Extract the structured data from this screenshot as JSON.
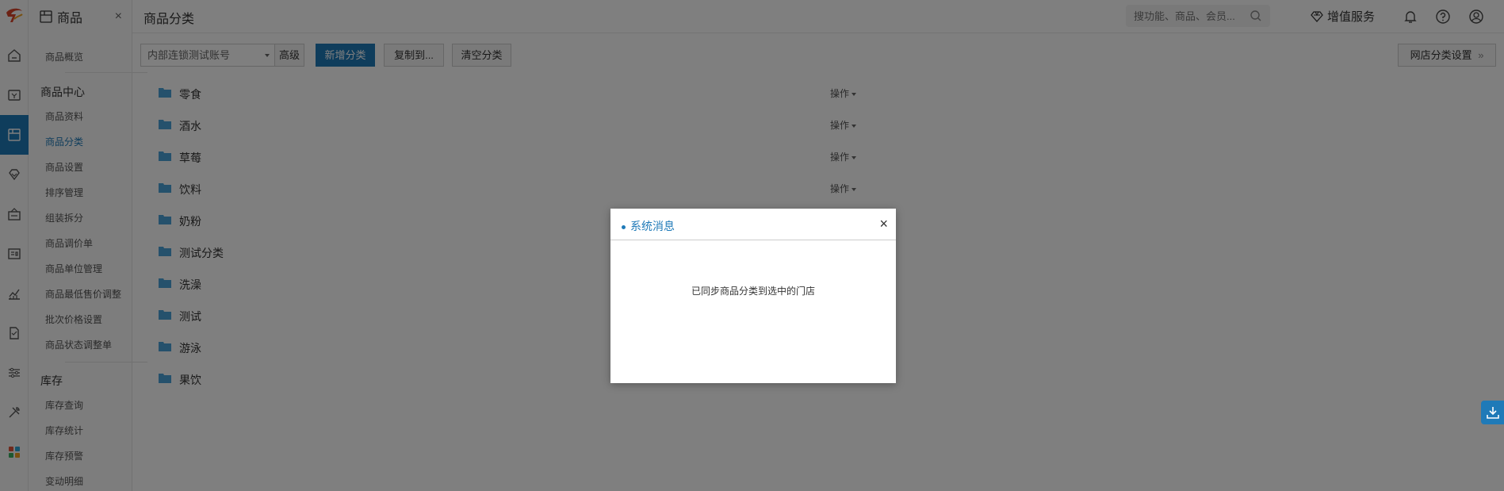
{
  "module": {
    "title": "商品",
    "close": "×"
  },
  "submenu": {
    "overview": "商品概览",
    "group_center": "商品中心",
    "center_items": [
      "商品资料",
      "商品分类",
      "商品设置",
      "排序管理",
      "组装拆分",
      "商品调价单",
      "商品单位管理",
      "商品最低售价调整",
      "批次价格设置",
      "商品状态调整单"
    ],
    "active_item": "商品分类",
    "group_stock": "库存",
    "stock_items": [
      "库存查询",
      "库存统计",
      "库存预警",
      "变动明细"
    ]
  },
  "header": {
    "page_title": "商品分类",
    "search_placeholder": "搜功能、商品、会员...",
    "value_added": "增值服务"
  },
  "toolbar": {
    "account_select": "内部连锁测试账号",
    "advanced": "高级",
    "add_category": "新增分类",
    "copy_to": "复制到...",
    "clear_categories": "清空分类",
    "shop_settings": "网店分类设置"
  },
  "categories": [
    "零食",
    "酒水",
    "草莓",
    "饮料",
    "奶粉",
    "测试分类",
    "洗澡",
    "测试",
    "游泳",
    "果饮"
  ],
  "operation_label": "操作",
  "dialog": {
    "title": "系统消息",
    "message": "已同步商品分类到选中的门店",
    "close": "×"
  },
  "colors": {
    "accent": "#1f7ab8",
    "mask": "rgba(0,0,0,0.5)"
  }
}
